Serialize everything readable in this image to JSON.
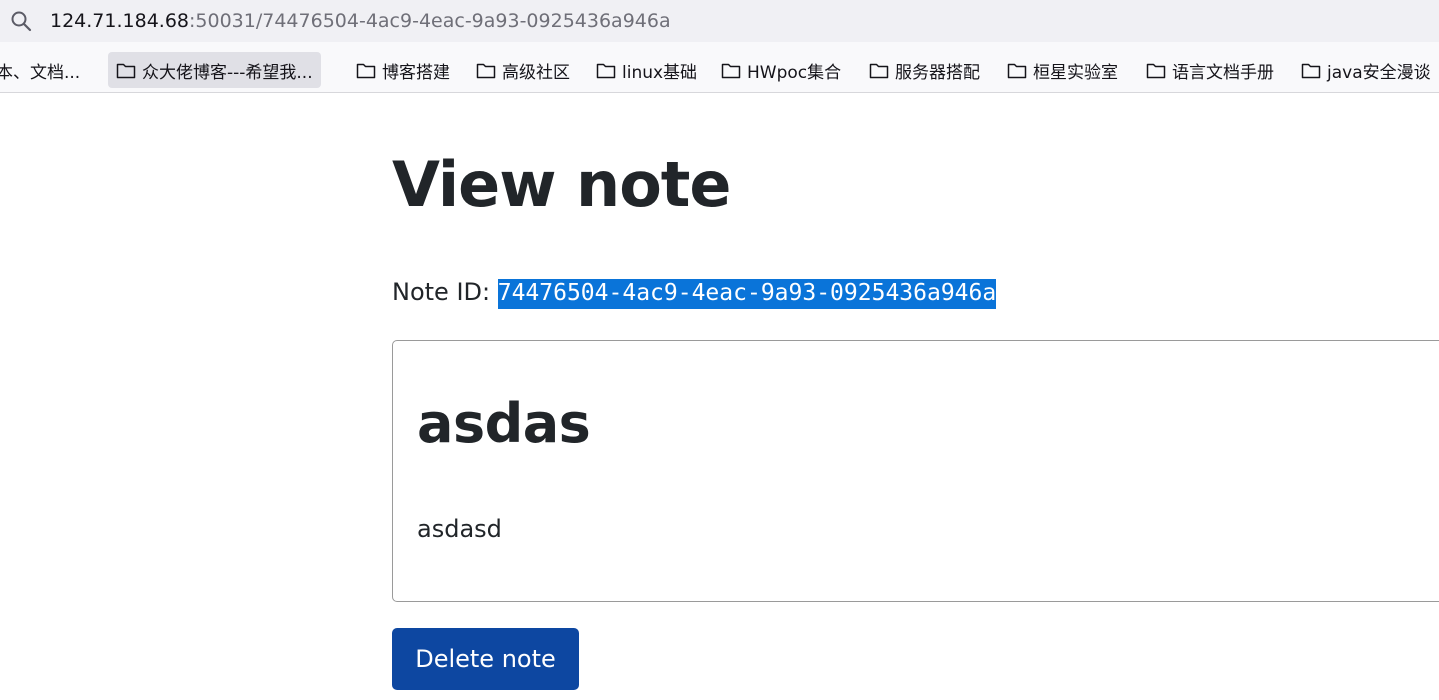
{
  "browser": {
    "address_bar": {
      "url_host": "124.71.184.68",
      "url_rest": ":50031/74476504-4ac9-4eac-9a93-0925436a946a"
    },
    "bookmarks": [
      {
        "label": "本、文档...",
        "icon": "none"
      },
      {
        "label": "众大佬博客---希望我...",
        "icon": "folder-icon",
        "active": true
      },
      {
        "label": "博客搭建",
        "icon": "folder-icon"
      },
      {
        "label": "高级社区",
        "icon": "folder-icon"
      },
      {
        "label": "linux基础",
        "icon": "folder-icon"
      },
      {
        "label": "HWpoc集合",
        "icon": "folder-icon"
      },
      {
        "label": "服务器搭配",
        "icon": "folder-icon"
      },
      {
        "label": "桓星实验室",
        "icon": "folder-icon"
      },
      {
        "label": "语言文档手册",
        "icon": "folder-icon"
      },
      {
        "label": "java安全漫谈",
        "icon": "folder-icon"
      }
    ]
  },
  "page": {
    "title": "View note",
    "note_id_label": "Note ID: ",
    "note_id": "74476504-4ac9-4eac-9a93-0925436a946a",
    "note": {
      "title": "asdas",
      "body": "asdasd"
    },
    "delete_button_label": "Delete note"
  },
  "colors": {
    "delete_button": "#0d47a1",
    "selection_highlight": "#0a74d9",
    "text": "#212529"
  }
}
